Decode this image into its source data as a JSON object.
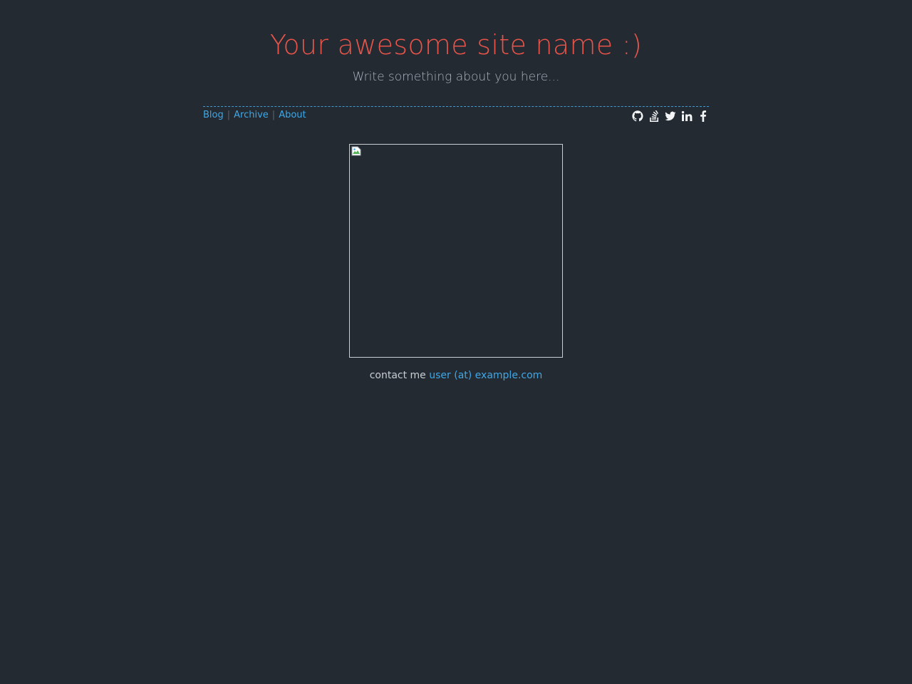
{
  "header": {
    "title": "Your awesome site name :)",
    "subtitle": "Write something about you here..."
  },
  "nav": {
    "items": [
      {
        "label": "Blog"
      },
      {
        "label": "Archive"
      },
      {
        "label": "About"
      }
    ],
    "separator": "|"
  },
  "social": {
    "icons": [
      "github-icon",
      "stackoverflow-icon",
      "twitter-icon",
      "linkedin-icon",
      "facebook-icon"
    ]
  },
  "avatar": {
    "icon": "broken-image-icon"
  },
  "contact": {
    "prefix": "contact me",
    "email": "user (at) example.com"
  },
  "colors": {
    "background": "#232a31",
    "title": "#e8544a",
    "link": "#3ea8e8",
    "text": "#c9ced3"
  }
}
